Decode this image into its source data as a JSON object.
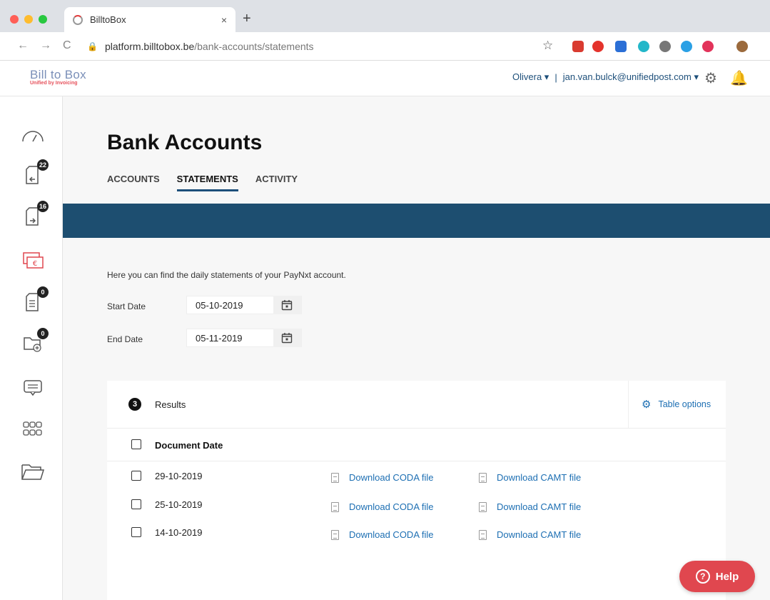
{
  "browser": {
    "tab_title": "BilltoBox",
    "tab_close": "×",
    "new_tab": "+",
    "url_host": "platform.billtobox.be",
    "url_path": "/bank-accounts/statements",
    "nav_back": "←",
    "nav_forward": "→",
    "nav_reload": "C",
    "star": "☆"
  },
  "app": {
    "logo_title": "Bill to Box",
    "logo_subtitle": "Unified by Invoicing",
    "company": "Olivera",
    "email": "jan.van.bulck@unifiedpost.com",
    "separator": "|"
  },
  "sidebar": {
    "items": [
      {
        "icon": "dashboard-gauge-icon",
        "badge": ""
      },
      {
        "icon": "incoming-documents-icon",
        "badge": "22"
      },
      {
        "icon": "outgoing-documents-icon",
        "badge": "16"
      },
      {
        "icon": "payments-euro-icon",
        "badge": ""
      },
      {
        "icon": "list-document-icon",
        "badge": "0"
      },
      {
        "icon": "add-folder-icon",
        "badge": "0"
      },
      {
        "icon": "messages-icon",
        "badge": ""
      },
      {
        "icon": "apps-grid-icon",
        "badge": ""
      },
      {
        "icon": "folder-icon",
        "badge": ""
      }
    ]
  },
  "page": {
    "title": "Bank Accounts",
    "tabs": [
      "ACCOUNTS",
      "STATEMENTS",
      "ACTIVITY"
    ],
    "intro": "Here you can find the daily statements of your PayNxt account.",
    "start_label": "Start Date",
    "start_value": "05-10-2019",
    "end_label": "End Date",
    "end_value": "05-11-2019"
  },
  "results": {
    "count": "3",
    "label": "Results",
    "table_options": "Table options",
    "column_header": "Document Date",
    "rows": [
      {
        "date": "29-10-2019",
        "coda": "Download CODA file",
        "camt": "Download CAMT file"
      },
      {
        "date": "25-10-2019",
        "coda": "Download CODA file",
        "camt": "Download CAMT file"
      },
      {
        "date": "14-10-2019",
        "coda": "Download CODA file",
        "camt": "Download CAMT file"
      }
    ]
  },
  "help": {
    "label": "Help",
    "icon": "?"
  },
  "colors": {
    "accent": "#1d4e70",
    "link": "#1d6fb3",
    "help": "#e0474f"
  }
}
